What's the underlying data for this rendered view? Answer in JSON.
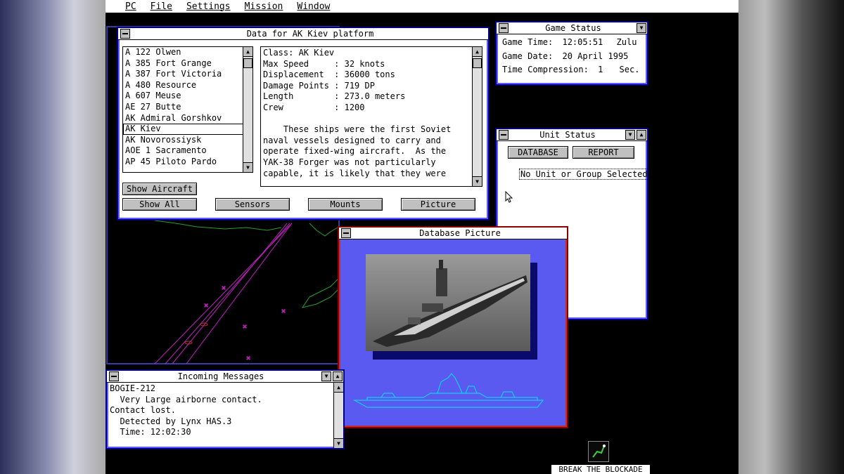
{
  "menubar": {
    "items": [
      "PC",
      "File",
      "Settings",
      "Mission",
      "Window"
    ]
  },
  "data_window": {
    "title": "Data for AK Kiev platform",
    "platform_list": [
      "A 122 Olwen",
      "A 385 Fort Grange",
      "A 387 Fort Victoria",
      "A 480 Resource",
      "A 607 Meuse",
      "AE 27 Butte",
      "AK Admiral Gorshkov",
      "AK Kiev",
      "AK Novorossiysk",
      "AOE 1 Sacramento",
      "AP 45 Piloto Pardo"
    ],
    "selected_item": "AK Kiev",
    "details": [
      "Class: AK Kiev",
      "Max Speed     : 32 knots",
      "Displacement  : 36000 tons",
      "Damage Points : 719 DP",
      "Length        : 273.0 meters",
      "Crew          : 1200",
      "",
      "    These ships were the first Soviet",
      "naval vessels designed to carry and",
      "operate fixed-wing aircraft.  As the",
      "YAK-38 Forger was not particularly",
      "capable, it is likely that they were"
    ],
    "buttons": {
      "show_aircraft": "Show Aircraft",
      "show_all": "Show All",
      "sensors": "Sensors",
      "mounts": "Mounts",
      "picture": "Picture"
    }
  },
  "game_status": {
    "title": "Game Status",
    "time_label": "Game Time:",
    "time_value": "12:05:51",
    "time_zone": "Zulu",
    "date_label": "Game Date:",
    "date_value": "20 April 1995",
    "compression_label": "Time Compression:",
    "compression_value": "1",
    "compression_unit": "Sec."
  },
  "unit_status": {
    "title": "Unit Status",
    "database_button": "DATABASE",
    "report_button": "REPORT",
    "status_text": "No Unit or Group Selected."
  },
  "database_picture": {
    "title": "Database Picture"
  },
  "messages": {
    "title": "Incoming Messages",
    "lines": [
      "BOGIE-212",
      "  Very Large airborne contact.",
      "Contact lost.",
      "  Detected by Lynx HAS.3",
      "  Time: 12:02:30"
    ]
  },
  "desktop_icon": {
    "label": "BREAK THE BLOCKADE"
  },
  "colors": {
    "window_border": "#000080",
    "picture_border": "#8b0000",
    "picture_bg": "#5a5af0",
    "map_coast": "#2aa02a",
    "map_track": "#c020c0"
  }
}
